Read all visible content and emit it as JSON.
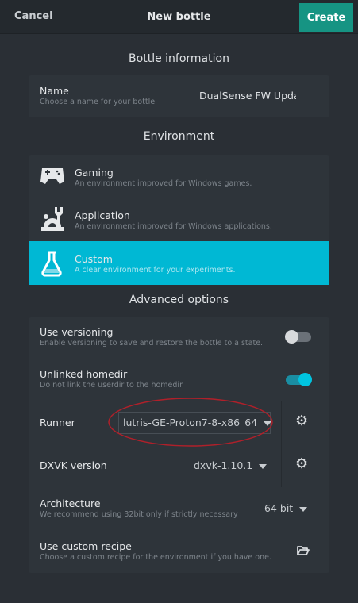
{
  "header": {
    "cancel": "Cancel",
    "title": "New bottle",
    "create": "Create"
  },
  "bottle_info": {
    "title": "Bottle information",
    "name_label": "Name",
    "name_sub": "Choose a name for your bottle",
    "name_value": "DualSense FW Upda"
  },
  "environment": {
    "title": "Environment",
    "items": [
      {
        "label": "Gaming",
        "sub": "An environment improved for Windows games.",
        "icon": "gamepad-icon",
        "selected": false
      },
      {
        "label": "Application",
        "sub": "An environment improved for Windows applications.",
        "icon": "application-icon",
        "selected": false
      },
      {
        "label": "Custom",
        "sub": "A clear environment for your experiments.",
        "icon": "flask-icon",
        "selected": true
      }
    ]
  },
  "advanced": {
    "title": "Advanced options",
    "versioning": {
      "label": "Use versioning",
      "sub": "Enable versioning to save and restore the bottle to a state.",
      "on": false
    },
    "homedir": {
      "label": "Unlinked homedir",
      "sub": "Do not link the userdir to the homedir",
      "on": true
    },
    "runner": {
      "label": "Runner",
      "value": "lutris-GE-Proton7-8-x86_64"
    },
    "dxvk": {
      "label": "DXVK version",
      "value": "dxvk-1.10.1"
    },
    "arch": {
      "label": "Architecture",
      "sub": "We recommend using 32bit only if strictly necessary",
      "value": "64 bit"
    },
    "recipe": {
      "label": "Use custom recipe",
      "sub": "Choose a custom recipe for the environment if you have one."
    }
  },
  "colors": {
    "accent": "#00b8d4",
    "create": "#169483",
    "annotation": "#b0202a"
  }
}
